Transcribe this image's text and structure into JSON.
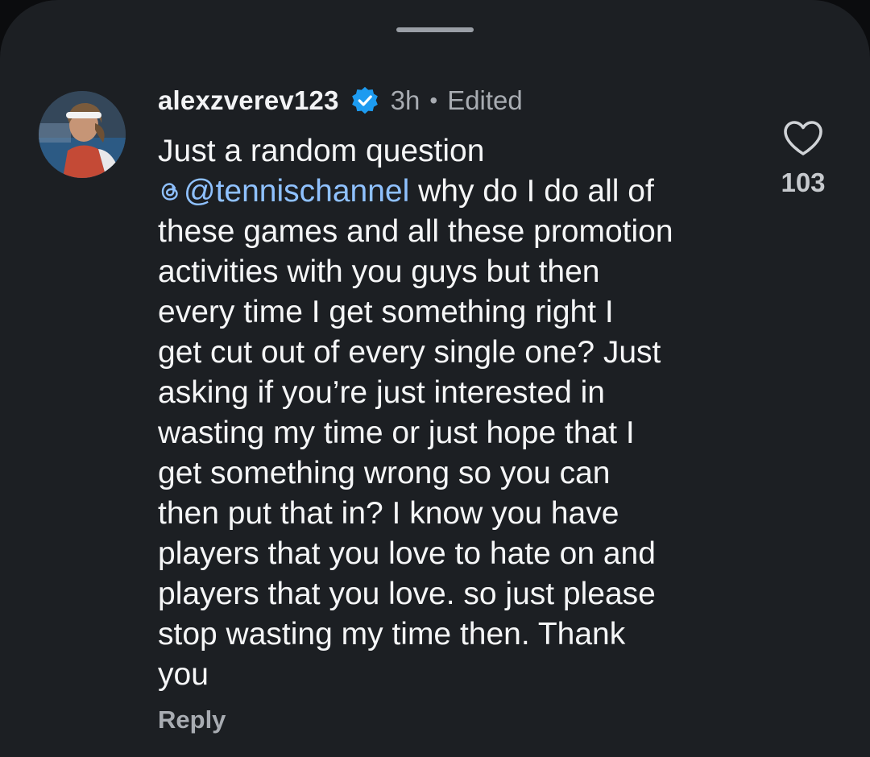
{
  "comment": {
    "username": "alexzverev123",
    "time_ago": "3h",
    "separator": "•",
    "edited_label": "Edited",
    "text_lines": [
      "Just a random question",
      "@tennischannel",
      " why do I do all of",
      "these games and all these promotion",
      "activities with you guys but then",
      "every time I get something right I",
      "get cut out of every single one? Just",
      "asking if you’re just interested in",
      "wasting my time or just hope that I",
      "get something wrong so you can",
      "then put that in? I know you have",
      "players that you love to hate on and",
      "players that you love. so just please",
      "stop wasting my time then. Thank",
      "you"
    ],
    "like_count": "103",
    "reply_label": "Reply"
  },
  "icons": {
    "verified": "verified-badge-icon",
    "like": "heart-outline-icon",
    "mention_prefix": "threads-icon"
  },
  "colors": {
    "background": "#1c1f23",
    "mention": "#8fc1ff",
    "verified_badge": "#1d9bf0",
    "secondary_text": "#a8acb2"
  }
}
